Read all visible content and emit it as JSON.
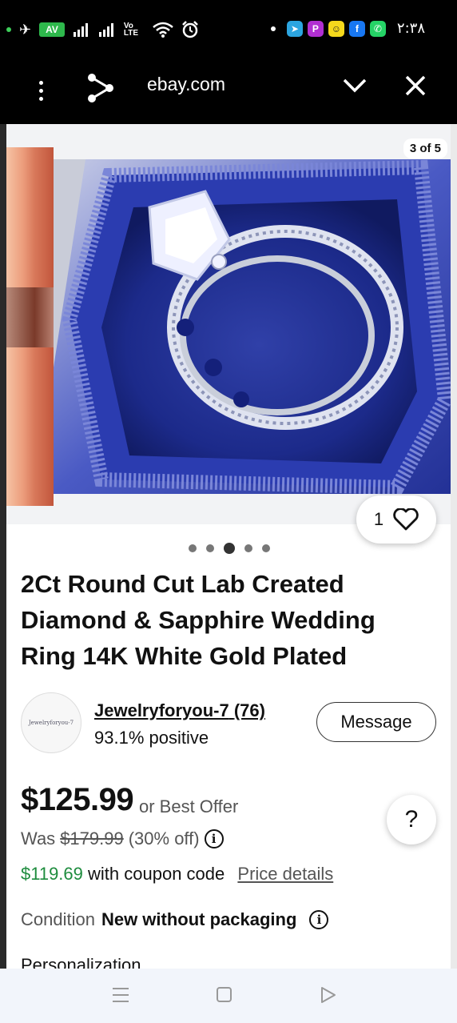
{
  "status_bar": {
    "network_badge": "AV",
    "volte_label": "Vo LTE",
    "time": "٢:٣٨",
    "apps": [
      {
        "icon": "telegram-icon",
        "letter": "➤",
        "color": "#2ca5e0"
      },
      {
        "icon": "picsart-icon",
        "letter": "P",
        "color": "#b12fd1"
      },
      {
        "icon": "snapchat-icon",
        "letter": "☺",
        "color": "#f4d81c"
      },
      {
        "icon": "facebook-icon",
        "letter": "f",
        "color": "#1877f2"
      },
      {
        "icon": "whatsapp-icon",
        "letter": "✆",
        "color": "#25d366"
      }
    ]
  },
  "browser": {
    "url": "ebay.com"
  },
  "gallery": {
    "counter": "3 of 5",
    "watch_count": "1",
    "dots": [
      false,
      false,
      true,
      false,
      false
    ]
  },
  "listing": {
    "title": "2Ct Round Cut Lab Created Diamond & Sapphire Wedding Ring 14K White Gold Plated",
    "seller": {
      "name": "Jewelryforyou-7",
      "feedback_count": "(76)",
      "positive": "93.1% positive",
      "avatar_text": "Jewelryforyou-7",
      "message_label": "Message"
    },
    "price": "$125.99",
    "best_offer": "or Best Offer",
    "was_label": "Was",
    "was_price": "$179.99",
    "discount": "(30% off)",
    "coupon_price": "$119.69",
    "coupon_text": "with coupon code",
    "price_details": "Price details",
    "condition_label": "Condition",
    "condition_value": "New without packaging",
    "next_section": "Personalization",
    "help_label": "?"
  },
  "colors": {
    "accent_green": "#1e8c3e",
    "ring_box_blue": "#2a3aa8"
  }
}
